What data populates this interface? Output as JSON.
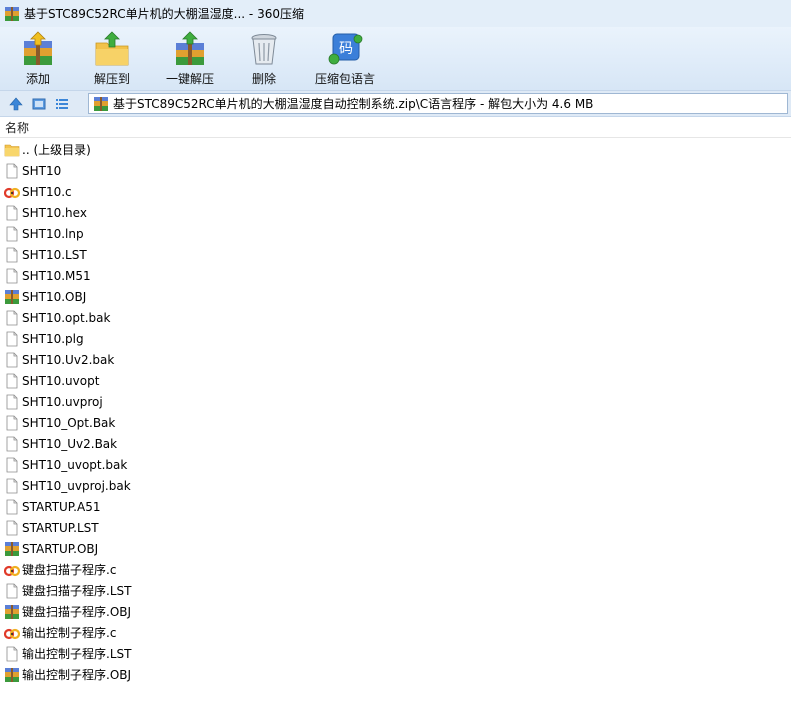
{
  "window": {
    "title": "基于STC89C52RC单片机的大棚温湿度... - 360压缩"
  },
  "toolbar": {
    "add_label": "添加",
    "extract_to_label": "解压到",
    "one_click_extract_label": "一键解压",
    "delete_label": "删除",
    "language_label": "压缩包语言",
    "language_icon_text": "码"
  },
  "address": {
    "path": "基于STC89C52RC单片机的大棚温湿度自动控制系统.zip\\C语言程序 - 解包大小为 4.6 MB"
  },
  "list": {
    "column_name": "名称",
    "items": [
      {
        "name": ".. (上级目录)",
        "type": "folder"
      },
      {
        "name": "SHT10",
        "type": "file"
      },
      {
        "name": "SHT10.c",
        "type": "csource"
      },
      {
        "name": "SHT10.hex",
        "type": "file"
      },
      {
        "name": "SHT10.lnp",
        "type": "file"
      },
      {
        "name": "SHT10.LST",
        "type": "file"
      },
      {
        "name": "SHT10.M51",
        "type": "file"
      },
      {
        "name": "SHT10.OBJ",
        "type": "archive"
      },
      {
        "name": "SHT10.opt.bak",
        "type": "file"
      },
      {
        "name": "SHT10.plg",
        "type": "file"
      },
      {
        "name": "SHT10.Uv2.bak",
        "type": "file"
      },
      {
        "name": "SHT10.uvopt",
        "type": "file"
      },
      {
        "name": "SHT10.uvproj",
        "type": "file"
      },
      {
        "name": "SHT10_Opt.Bak",
        "type": "file"
      },
      {
        "name": "SHT10_Uv2.Bak",
        "type": "file"
      },
      {
        "name": "SHT10_uvopt.bak",
        "type": "file"
      },
      {
        "name": "SHT10_uvproj.bak",
        "type": "file"
      },
      {
        "name": "STARTUP.A51",
        "type": "file"
      },
      {
        "name": "STARTUP.LST",
        "type": "file"
      },
      {
        "name": "STARTUP.OBJ",
        "type": "archive"
      },
      {
        "name": "键盘扫描子程序.c",
        "type": "csource"
      },
      {
        "name": "键盘扫描子程序.LST",
        "type": "file"
      },
      {
        "name": "键盘扫描子程序.OBJ",
        "type": "archive"
      },
      {
        "name": "输出控制子程序.c",
        "type": "csource"
      },
      {
        "name": "输出控制子程序.LST",
        "type": "file"
      },
      {
        "name": "输出控制子程序.OBJ",
        "type": "archive"
      }
    ]
  }
}
